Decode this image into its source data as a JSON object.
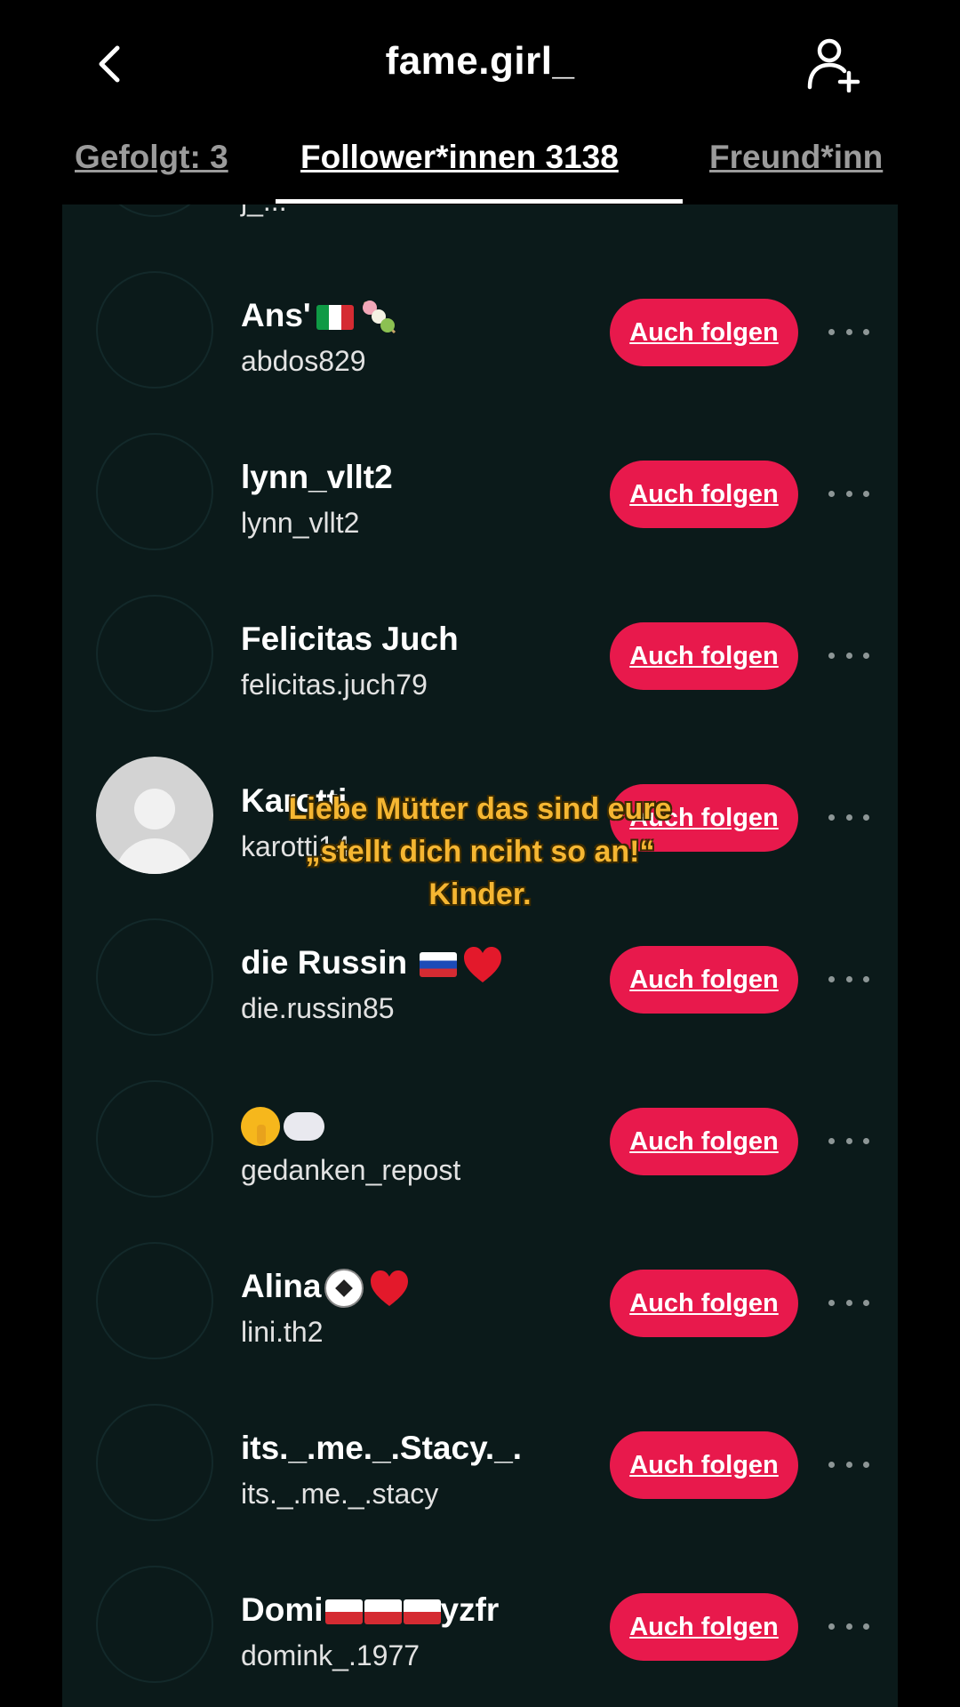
{
  "header": {
    "title": "fame.girl_",
    "back_icon": "chevron-left-icon",
    "add_user_icon": "add-user-icon"
  },
  "tabs": [
    {
      "label": "Gefolgt: 3",
      "active": false
    },
    {
      "label": "Follower*innen 3138",
      "active": true
    },
    {
      "label": "Freund*inn",
      "active": false
    }
  ],
  "follow_label": "Auch folgen",
  "partial_handle": "j_...",
  "users": [
    {
      "name": "Ans'",
      "handle": "abdos829"
    },
    {
      "name": "lynn_vllt2",
      "handle": "lynn_vllt2"
    },
    {
      "name": "Felicitas Juch",
      "handle": "felicitas.juch79"
    },
    {
      "name": "Karotti",
      "handle": "karotti14"
    },
    {
      "name": "die Russin",
      "handle": "die.russin85"
    },
    {
      "name": "",
      "handle": "gedanken_repost"
    },
    {
      "name": "Alina",
      "handle": "lini.th2"
    },
    {
      "name": "its._.me._.Stacy._.",
      "handle": "its._.me._.stacy"
    },
    {
      "name": "Domi",
      "name_suffix": "yzfr",
      "handle": "domink_.1977"
    }
  ],
  "caption": {
    "line1": "Liebe Mütter das sind eure",
    "line2": "„stellt dich nciht so an!“",
    "line3": "Kinder."
  },
  "colors": {
    "panel_bg": "#0b1a1a",
    "follow_button": "#e8194c",
    "caption_text": "#f5b632"
  }
}
